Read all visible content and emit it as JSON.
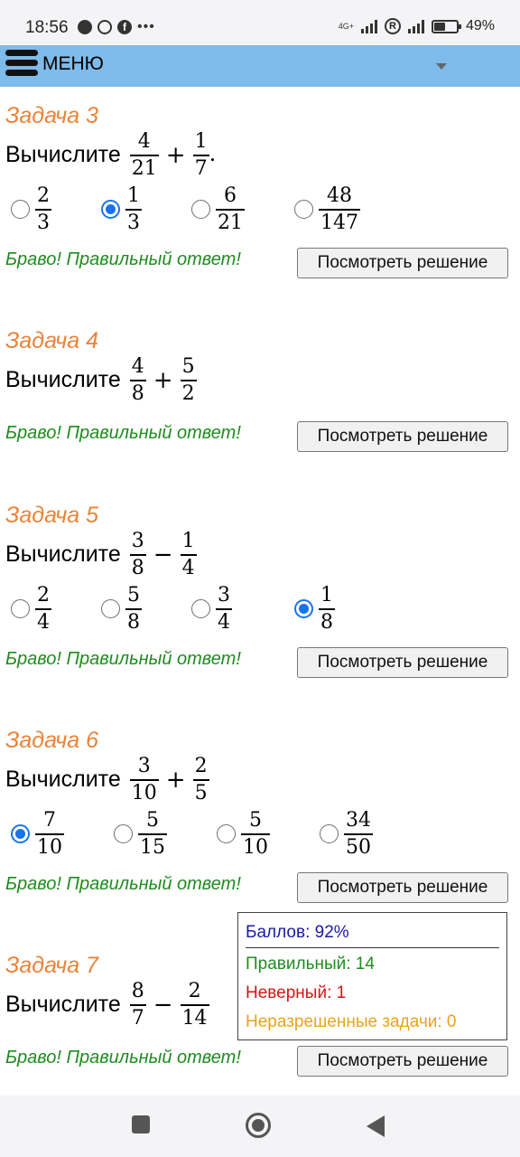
{
  "status_bar": {
    "time": "18:56",
    "network": "4G+",
    "battery": "49%"
  },
  "menu": {
    "label": "МЕНЮ"
  },
  "tasks": [
    {
      "title": "Задача 3",
      "question_word": "Вычислите",
      "expr": {
        "a": [
          "4",
          "21"
        ],
        "op": "+",
        "b": [
          "1",
          "7"
        ],
        "end": "."
      },
      "options": [
        [
          "2",
          "3"
        ],
        [
          "1",
          "3"
        ],
        [
          "6",
          "21"
        ],
        [
          "48",
          "147"
        ]
      ],
      "selected": 1,
      "feedback": "Браво! Правильный ответ!",
      "button": "Посмотреть решение"
    },
    {
      "title": "Задача 4",
      "question_word": "Вычислите",
      "expr": {
        "a": [
          "4",
          "8"
        ],
        "op": "+",
        "b": [
          "5",
          "2"
        ],
        "end": ""
      },
      "options": [],
      "selected": -1,
      "feedback": "Браво! Правильный ответ!",
      "button": "Посмотреть решение"
    },
    {
      "title": "Задача 5",
      "question_word": "Вычислите",
      "expr": {
        "a": [
          "3",
          "8"
        ],
        "op": "−",
        "b": [
          "1",
          "4"
        ],
        "end": ""
      },
      "options": [
        [
          "2",
          "4"
        ],
        [
          "5",
          "8"
        ],
        [
          "3",
          "4"
        ],
        [
          "1",
          "8"
        ]
      ],
      "selected": 3,
      "feedback": "Браво! Правильный ответ!",
      "button": "Посмотреть решение"
    },
    {
      "title": "Задача 6",
      "question_word": "Вычислите",
      "expr": {
        "a": [
          "3",
          "10"
        ],
        "op": "+",
        "b": [
          "2",
          "5"
        ],
        "end": ""
      },
      "options": [
        [
          "7",
          "10"
        ],
        [
          "5",
          "15"
        ],
        [
          "5",
          "10"
        ],
        [
          "34",
          "50"
        ]
      ],
      "selected": 0,
      "feedback": "Браво! Правильный ответ!",
      "button": "Посмотреть решение"
    },
    {
      "title": "Задача 7",
      "question_word": "Вычислите",
      "expr": {
        "a": [
          "8",
          "7"
        ],
        "op": "−",
        "b": [
          "2",
          "14"
        ],
        "end": ""
      },
      "options": [],
      "selected": -1,
      "feedback": "Браво! Правильный ответ!",
      "button": "Посмотреть решение"
    }
  ],
  "score": {
    "total": "Баллов: 92%",
    "correct": "Правильный: 14",
    "wrong": "Неверный: 1",
    "unresolved": "Неразрешенные задачи: 0"
  },
  "colors": {
    "menu_bg": "#7fbbea",
    "task_title": "#e8833a",
    "feedback": "#1f8c1f",
    "radio_selected": "#1a73e8"
  }
}
